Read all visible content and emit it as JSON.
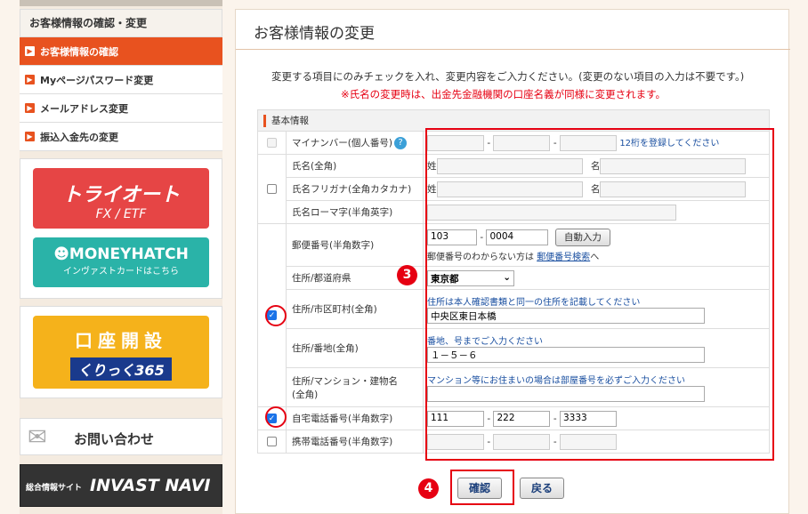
{
  "sidebar": {
    "title": "お客様情報の確認・変更",
    "items": [
      {
        "label": "お客様情報の確認"
      },
      {
        "label": "Myページパスワード変更"
      },
      {
        "label": "メールアドレス変更"
      },
      {
        "label": "振込入金先の変更"
      }
    ],
    "banners": {
      "triauto_main": "トライオート",
      "triauto_sub": "FX / ETF",
      "moneyhatch_main": "MONEYHATCH",
      "moneyhatch_sub": "インヴァストカードはこちら",
      "open_account": "口座開設",
      "kurikku": "くりっく365",
      "contact": "お問い合わせ",
      "navi_prefix": "総合情報サイト",
      "navi": "INVAST NAVI"
    }
  },
  "main": {
    "title": "お客様情報の変更",
    "intro": "変更する項目にのみチェックを入れ、変更内容をご入力ください。(変更のない項目の入力は不要です。)",
    "warning": "※氏名の変更時は、出金先金融機関の口座名義が同様に変更されます。",
    "section_header": "基本情報",
    "rows": {
      "mynumber_label": "マイナンバー(個人番号)",
      "mynumber_hint": "12桁を登録してください",
      "name_label": "氏名(全角)",
      "name_kana_label": "氏名フリガナ(全角カタカナ)",
      "name_roman_label": "氏名ローマ字(半角英字)",
      "sei": "姓",
      "mei": "名",
      "postal_label": "郵便番号(半角数字)",
      "postal_1": "103",
      "postal_2": "0004",
      "auto_button": "自動入力",
      "postal_note_prefix": "郵便番号のわからない方は",
      "postal_link": "郵便番号検索",
      "postal_note_suffix": "へ",
      "pref_label": "住所/都道府県",
      "pref_value": "東京都",
      "city_label": "住所/市区町村(全角)",
      "city_hint": "住所は本人確認書類と同一の住所を記載してください",
      "city_value": "中央区東日本橋",
      "block_label": "住所/番地(全角)",
      "block_hint": "番地、号までご入力ください",
      "block_value": "１－５－６",
      "building_label": "住所/マンション・建物名",
      "building_label2": "(全角)",
      "building_hint": "マンション等にお住まいの場合は部屋番号を必ずご入力ください",
      "home_tel_label": "自宅電話番号(半角数字)",
      "home_tel_1": "111",
      "home_tel_2": "222",
      "home_tel_3": "3333",
      "mobile_label": "携帯電話番号(半角数字)",
      "dash": "-"
    },
    "confirm_button": "確認",
    "back_button": "戻る"
  },
  "annotations": {
    "step3": "3",
    "step4": "4"
  },
  "colors": {
    "accent": "#e8521f",
    "highlight": "#e60012",
    "link": "#1a4fa0"
  }
}
